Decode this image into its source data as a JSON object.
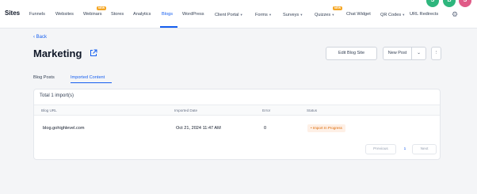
{
  "nav": {
    "brand": "Sites",
    "items": [
      {
        "label": "Funnels",
        "active": false
      },
      {
        "label": "Websites",
        "active": false
      },
      {
        "label": "Webinars",
        "active": false,
        "badge": "NEW"
      },
      {
        "label": "Stores",
        "active": false
      },
      {
        "label": "Analytics",
        "active": false
      },
      {
        "label": "Blogs",
        "active": true
      },
      {
        "label": "WordPress",
        "active": false
      },
      {
        "label": "Client Portal",
        "active": false,
        "caret": true
      },
      {
        "label": "Forms",
        "active": false,
        "caret": true
      },
      {
        "label": "Surveys",
        "active": false,
        "caret": true
      },
      {
        "label": "Quizzes",
        "active": false,
        "caret": true,
        "badge": "NEW"
      },
      {
        "label": "Chat Widget",
        "active": false
      },
      {
        "label": "QR Codes",
        "active": false,
        "caret": true
      },
      {
        "label": "URL Redirects",
        "active": false
      }
    ],
    "caret_glyph": "▾",
    "avatars": [
      {
        "letter": "S",
        "color": "#2eb67d"
      },
      {
        "letter": "B",
        "color": "#2eb67d"
      },
      {
        "letter": "S",
        "color": "#e05a87"
      }
    ],
    "gear_glyph": "⚙"
  },
  "header": {
    "back_label": "Back",
    "title": "Marketing",
    "edit_button": "Edit Blog Site",
    "new_post_button": "New Post",
    "dropdown_glyph": "⌄",
    "more_glyph": "⋮"
  },
  "tabs": [
    {
      "label": "Blog Posts",
      "active": false
    },
    {
      "label": "Imported Content",
      "active": true
    }
  ],
  "table": {
    "total": "Total 1 import(s)",
    "columns": [
      "Blog URL",
      "Imported Date",
      "Error",
      "Status"
    ],
    "rows": [
      {
        "url": "blog.gohighlevel.com",
        "date": "Oct 21, 2024 11:47 AM",
        "error": "0",
        "status": "• Import In Progress"
      }
    ]
  },
  "pagination": {
    "previous": "Previous",
    "current": "1",
    "next": "Next"
  },
  "colors": {
    "accent": "#155eef",
    "status_bg": "#fef0e6",
    "status_text": "#dc6803"
  }
}
